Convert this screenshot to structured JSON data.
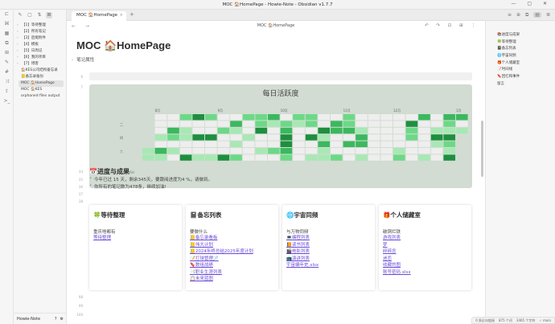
{
  "window": {
    "title": "MOC 🏠HomePage - Howie-Note - Obsidian v1.7.7",
    "controls": "— ▢ ✕"
  },
  "ribbon": {
    "icons": [
      "sidebar-toggle-icon",
      "graph-icon",
      "calendar-icon",
      "template-icon",
      "command-icon",
      "canvas-icon",
      "tag-icon",
      "random-icon",
      "publish-icon",
      "terminal-icon"
    ],
    "glyphs": [
      "⊏",
      "⌘",
      "▦",
      "⧉",
      "⊞",
      "✎",
      "#",
      "⤨",
      "⇪",
      ">_"
    ]
  },
  "left": {
    "tools": [
      "✎",
      "▢",
      "⇅",
      "⊠"
    ],
    "tree": [
      {
        "label": "【1】等待整理",
        "folder": true
      },
      {
        "label": "【2】所有笔记",
        "folder": true
      },
      {
        "label": "【3】后缀附件",
        "folder": true
      },
      {
        "label": "【4】模板",
        "folder": true
      },
      {
        "label": "【5】日周记",
        "folder": true
      },
      {
        "label": "【6】我的项目",
        "folder": true
      },
      {
        "label": "【7】博客",
        "folder": true
      },
      {
        "label": "🏠KES公司结构备忘录",
        "folder": false
      },
      {
        "label": "📒备忘录备份",
        "folder": false
      },
      {
        "label": "MOC 🏠HomePage",
        "folder": false,
        "selected": true
      },
      {
        "label": "MOC 🏠KES",
        "folder": false
      },
      {
        "label": "orphaned files output",
        "folder": false
      }
    ],
    "vault": "Howie-Note",
    "vault_icons": [
      "?",
      "⚙"
    ]
  },
  "tabs": [
    {
      "label": "MOC 🏠HomePage",
      "close": "×"
    }
  ],
  "tab_plus": "+",
  "right_top_icons": [
    "≡",
    "⊕",
    "⧉",
    "▤",
    "≣"
  ],
  "view": {
    "nav": "← → ",
    "breadcrumb": "MOC 🏠HomePage",
    "actions": "↶ ↷ ⊡ ⊞ ⋮"
  },
  "note": {
    "title": "MOC 🏠HomePage",
    "properties": "笔记属性",
    "line_numbers": {
      "a": "6",
      "b": "7",
      "c": "34",
      "d": "35",
      "e": "36",
      "f": "37",
      "g": "38",
      "h": "39",
      "i": "98",
      "j": "99",
      "k": "100"
    },
    "heatmap_title": "每日活跃度",
    "progress_title": "📅进度与成果",
    "progress_small": "RH",
    "bullet1": "今年已过 15 天，剩余345天，要跟阅进度为4 %，请做到。",
    "bullet2": "你所有的笔记数为478条，继续加油!"
  },
  "heatmap": {
    "months": [
      "8月",
      "9月",
      "10月",
      "11月",
      "12月",
      "1月"
    ],
    "days": [
      "二",
      "四",
      "六"
    ],
    "colors": {
      "empty": "#eeeeee",
      "l1": "#a8e8b4",
      "l2": "#6cd987",
      "l3": "#3bb85e",
      "l4": "#1e8f3f"
    }
  },
  "cards": [
    {
      "icon": "🍀",
      "title": "等待整理",
      "sub": "重庆啥都有",
      "links": [
        "等待整理"
      ]
    },
    {
      "icon": "📓",
      "title": "备忘列表",
      "sub": "要做什么",
      "links": [
        "📒备忘录看板",
        "📒伟大计划",
        "📒2024年终总结2025年度计划",
        "📝打球管理🏸",
        "🔖数组战绩",
        "📑职业生涯列表",
        "📋未来蓝图"
      ]
    },
    {
      "icon": "🌐",
      "title": "宇宙同频",
      "sub": "与万物同频",
      "links": [
        "💻编程列表",
        "📙读书列表",
        "🎬电影列表",
        "📺演讲列表",
        "宇宙编年史.xlsx"
      ]
    },
    {
      "icon": "🎁",
      "title": "个人储藏室",
      "sub": "破铜烂铁",
      "links": [
        "游戏列表",
        "梦",
        "碎碎念",
        "迷恋",
        "收藏的图",
        "账号密码.xlsx"
      ]
    }
  ],
  "outline": [
    "📚进度与成果",
    "🍀等待整理",
    "📓备忘列表",
    "🌐宇宙同频",
    "🎁个人储藏室",
    "📝时间线",
    "🔖回忆和事件",
    "留言"
  ],
  "status": [
    "0 条反向链接",
    "875 个词",
    "3465 个字符",
    "✓ main"
  ]
}
